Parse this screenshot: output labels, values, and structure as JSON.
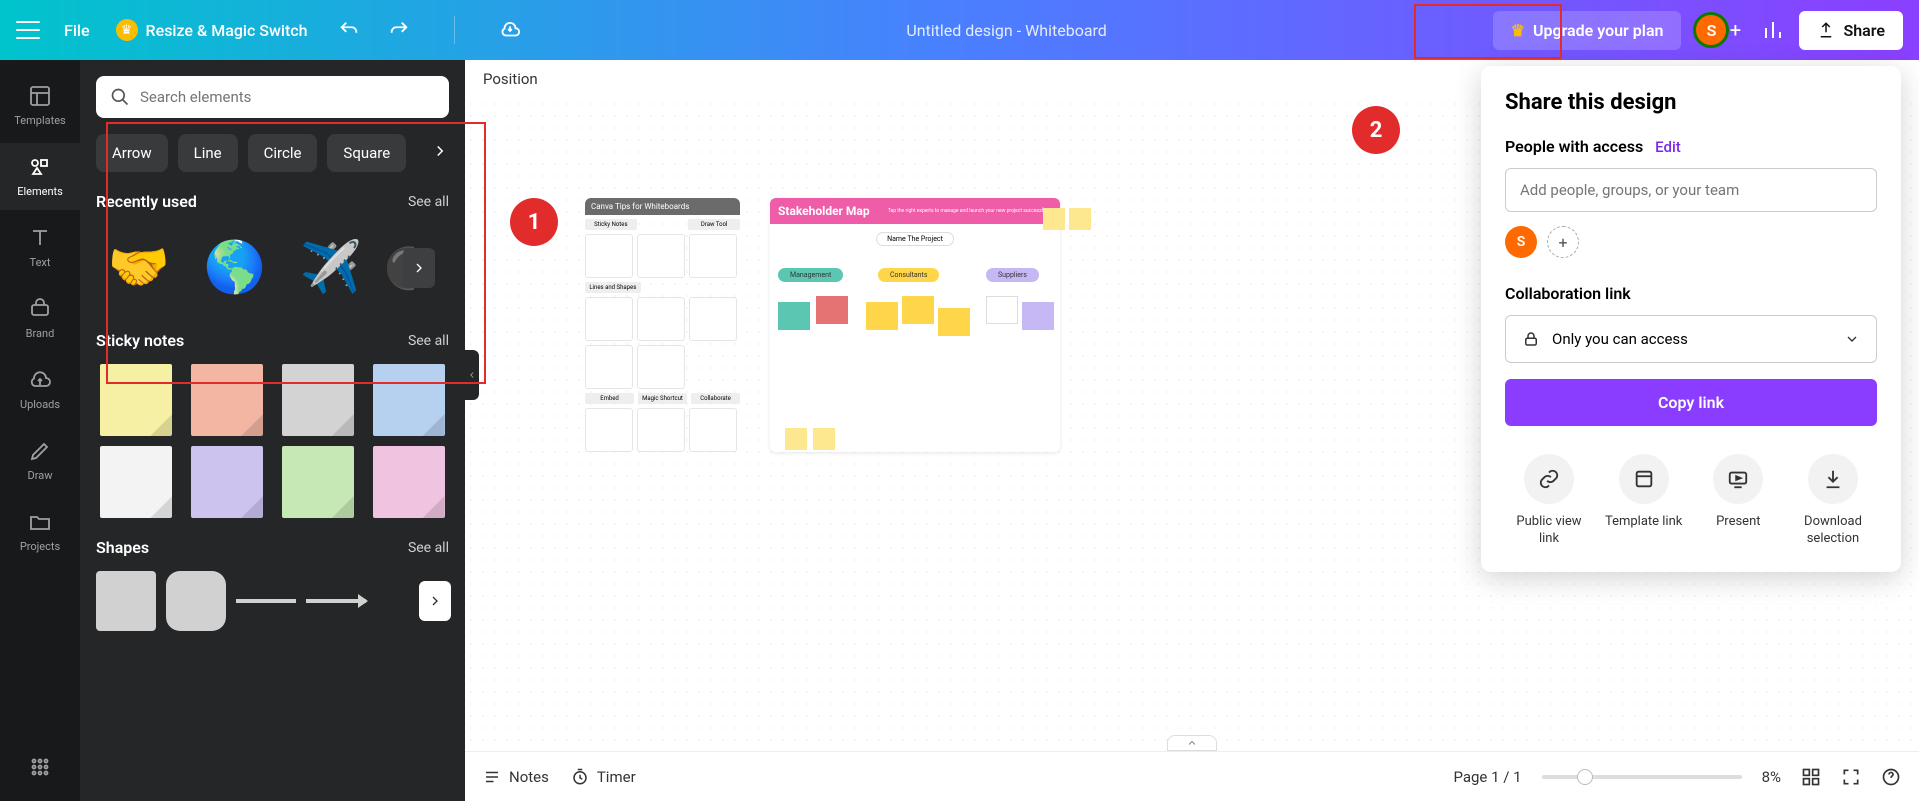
{
  "header": {
    "file": "File",
    "resize": "Resize & Magic Switch",
    "title": "Untitled design - Whiteboard",
    "upgrade": "Upgrade your plan",
    "avatar_initial": "S",
    "share": "Share"
  },
  "sidebar": {
    "items": [
      {
        "label": "Templates"
      },
      {
        "label": "Elements"
      },
      {
        "label": "Text"
      },
      {
        "label": "Brand"
      },
      {
        "label": "Uploads"
      },
      {
        "label": "Draw"
      },
      {
        "label": "Projects"
      }
    ]
  },
  "elements_panel": {
    "search_placeholder": "Search elements",
    "chips": [
      "Arrow",
      "Line",
      "Circle",
      "Square"
    ],
    "recently_used": {
      "title": "Recently used",
      "see_all": "See all"
    },
    "sticky_notes": {
      "title": "Sticky notes",
      "see_all": "See all"
    },
    "shapes": {
      "title": "Shapes",
      "see_all": "See all"
    },
    "sticky_colors": [
      "#f5f0a3",
      "#f2b6a3",
      "#d3d3d3",
      "#b6d0ef",
      "#f3f3f3",
      "#cdc3ef",
      "#c6e8b4",
      "#f0c3e0"
    ]
  },
  "canvas": {
    "position": "Position",
    "tips_title": "Canva Tips for Whiteboards",
    "tips_sections": [
      "Sticky Notes",
      "Draw Tool",
      "Lines and Shapes",
      "Embed",
      "Magic Shortcut",
      "Collaborate"
    ],
    "stakeholder_title": "Stakeholder Map",
    "stakeholder_subtitle": "Tap the right experts to manage and launch your new project successfully.",
    "name_project": "Name The Project",
    "categories": [
      "Management",
      "Consultants",
      "Suppliers"
    ]
  },
  "footer": {
    "notes": "Notes",
    "timer": "Timer",
    "page": "Page 1 / 1",
    "zoom": "8%"
  },
  "share_panel": {
    "title": "Share this design",
    "people_label": "People with access",
    "edit": "Edit",
    "people_placeholder": "Add people, groups, or your team",
    "avatar_initial": "S",
    "collab_label": "Collaboration link",
    "access_option": "Only you can access",
    "copy": "Copy link",
    "options": [
      {
        "label": "Public view link"
      },
      {
        "label": "Template link"
      },
      {
        "label": "Present"
      },
      {
        "label": "Download selection"
      }
    ]
  },
  "annotations": {
    "one": "1",
    "two": "2"
  }
}
